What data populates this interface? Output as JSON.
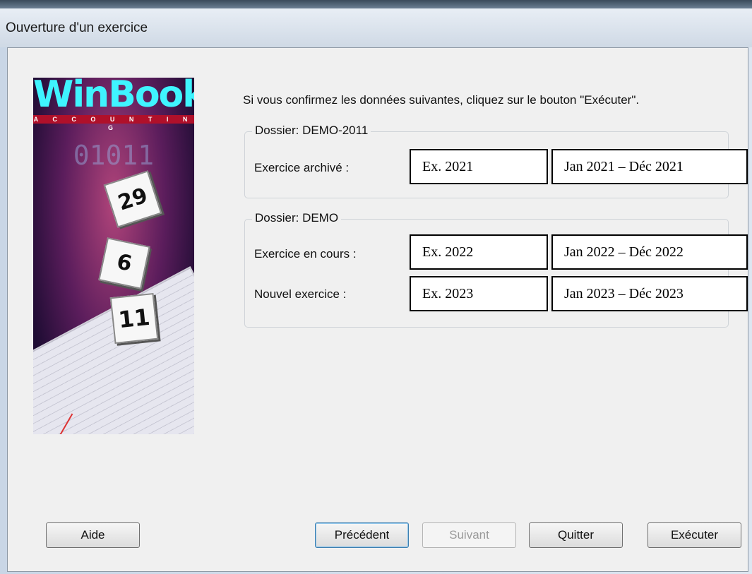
{
  "window": {
    "title": "Ouverture d'un exercice"
  },
  "logo": {
    "brand": "WinBooks",
    "subtitle": "A C C O U N T I N G",
    "binary": "01011",
    "cal_days": [
      "29",
      "6",
      "11"
    ]
  },
  "intro_text": "Si vous confirmez les données suivantes, cliquez sur le bouton  \"Exécuter\".",
  "groups": [
    {
      "title": "Dossier: DEMO-2011",
      "rows": [
        {
          "label": "Exercice archivé :",
          "exercise": "Ex. 2021",
          "period": "Jan 2021 – Déc 2021"
        }
      ]
    },
    {
      "title": "Dossier: DEMO",
      "rows": [
        {
          "label": "Exercice en cours :",
          "exercise": "Ex. 2022",
          "period": "Jan 2022 – Déc 2022"
        },
        {
          "label": "Nouvel exercice :",
          "exercise": "Ex. 2023",
          "period": "Jan 2023 – Déc 2023"
        }
      ]
    }
  ],
  "buttons": {
    "help": "Aide",
    "previous": "Précédent",
    "next": "Suivant",
    "quit": "Quitter",
    "execute": "Exécuter"
  }
}
